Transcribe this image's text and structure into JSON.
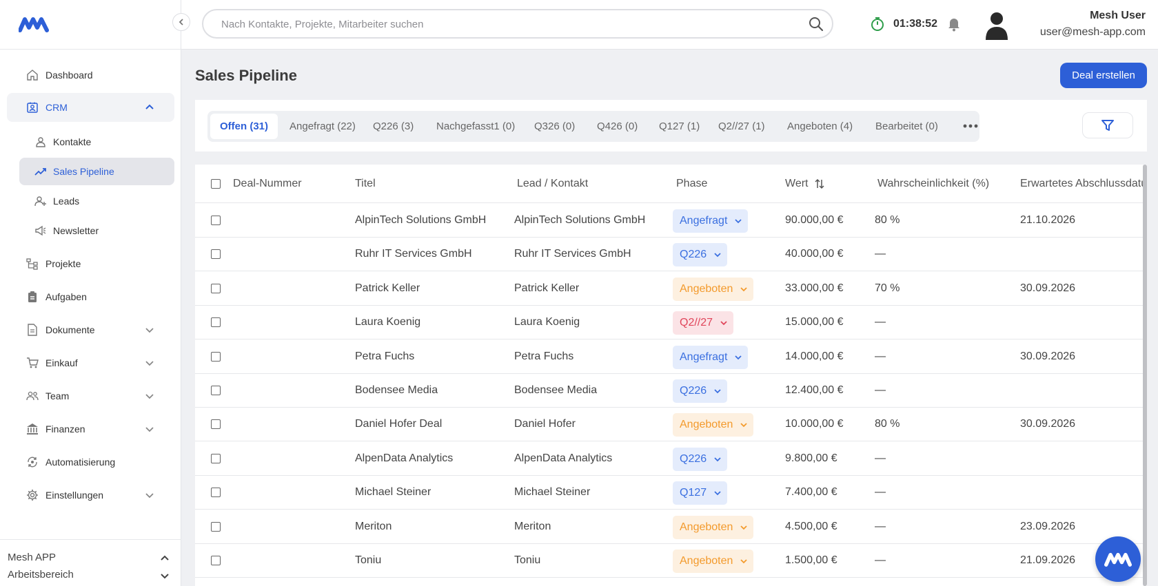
{
  "colors": {
    "accent": "#2d5fd7",
    "badge_blue": "#3a6fe0",
    "badge_orange": "#f39a2c",
    "badge_red": "#e0455a"
  },
  "topbar": {
    "search_placeholder": "Nach Kontakte, Projekte, Mitarbeiter suchen",
    "timer": "01:38:52",
    "user_name": "Mesh User",
    "user_email": "user@mesh-app.com"
  },
  "sidebar": {
    "items": [
      {
        "label": "Dashboard",
        "icon": "home-icon"
      },
      {
        "label": "CRM",
        "icon": "crm-icon"
      },
      {
        "label": "Kontakte",
        "icon": "user-icon"
      },
      {
        "label": "Sales Pipeline",
        "icon": "trending-up-icon"
      },
      {
        "label": "Leads",
        "icon": "user-plus-icon"
      },
      {
        "label": "Newsletter",
        "icon": "megaphone-icon"
      },
      {
        "label": "Projekte",
        "icon": "project-tree-icon"
      },
      {
        "label": "Aufgaben",
        "icon": "clipboard-icon"
      },
      {
        "label": "Dokumente",
        "icon": "document-icon"
      },
      {
        "label": "Einkauf",
        "icon": "cart-icon"
      },
      {
        "label": "Team",
        "icon": "team-icon"
      },
      {
        "label": "Finanzen",
        "icon": "bank-icon"
      },
      {
        "label": "Automatisierung",
        "icon": "automation-icon"
      },
      {
        "label": "Einstellungen",
        "icon": "gear-icon"
      }
    ],
    "footer": {
      "app": "Mesh APP",
      "workspace": "Arbeitsbereich"
    }
  },
  "main": {
    "title": "Sales Pipeline",
    "create_button": "Deal erstellen",
    "tabs": [
      "Offen (31)",
      "Angefragt (22)",
      "Q226 (3)",
      "Nachgefasst1 (0)",
      "Q326 (0)",
      "Q426 (0)",
      "Q127 (1)",
      "Q2//27 (1)",
      "Angeboten (4)",
      "Bearbeitet (0)"
    ],
    "columns": [
      "Deal-Nummer",
      "Titel",
      "Lead / Kontakt",
      "Phase",
      "Wert",
      "Wahrscheinlichkeit (%)",
      "Erwartetes Abschlussdatum"
    ],
    "rows": [
      {
        "deal": "",
        "title": "AlpinTech Solutions GmbH",
        "lead": "AlpinTech Solutions GmbH",
        "phase": "Angefragt",
        "value": "90.000,00 €",
        "prob": "80 %",
        "date": "21.10.2026"
      },
      {
        "deal": "",
        "title": "Ruhr IT Services GmbH",
        "lead": "Ruhr IT Services GmbH",
        "phase": "Q226",
        "value": "40.000,00 €",
        "prob": "—",
        "date": ""
      },
      {
        "deal": "",
        "title": "Patrick Keller",
        "lead": "Patrick Keller",
        "phase": "Angeboten",
        "value": "33.000,00 €",
        "prob": "70 %",
        "date": "30.09.2026"
      },
      {
        "deal": "",
        "title": "Laura Koenig",
        "lead": "Laura Koenig",
        "phase": "Q2//27",
        "value": "15.000,00 €",
        "prob": "—",
        "date": ""
      },
      {
        "deal": "",
        "title": "Petra Fuchs",
        "lead": "Petra Fuchs",
        "phase": "Angefragt",
        "value": "14.000,00 €",
        "prob": "—",
        "date": "30.09.2026"
      },
      {
        "deal": "",
        "title": "Bodensee Media",
        "lead": "Bodensee Media",
        "phase": "Q226",
        "value": "12.400,00 €",
        "prob": "—",
        "date": ""
      },
      {
        "deal": "",
        "title": "Daniel Hofer Deal",
        "lead": "Daniel Hofer",
        "phase": "Angeboten",
        "value": "10.000,00 €",
        "prob": "80 %",
        "date": "30.09.2026"
      },
      {
        "deal": "",
        "title": "AlpenData Analytics",
        "lead": "AlpenData Analytics",
        "phase": "Q226",
        "value": "9.800,00 €",
        "prob": "—",
        "date": ""
      },
      {
        "deal": "",
        "title": "Michael Steiner",
        "lead": "Michael Steiner",
        "phase": "Q127",
        "value": "7.400,00 €",
        "prob": "—",
        "date": ""
      },
      {
        "deal": "",
        "title": "Meriton",
        "lead": "Meriton",
        "phase": "Angeboten",
        "value": "4.500,00 €",
        "prob": "—",
        "date": "23.09.2026"
      },
      {
        "deal": "",
        "title": "Toniu",
        "lead": "Toniu",
        "phase": "Angeboten",
        "value": "1.500,00 €",
        "prob": "—",
        "date": "21.09.2026"
      }
    ]
  }
}
